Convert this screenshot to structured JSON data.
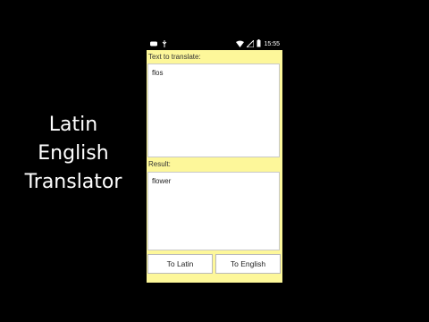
{
  "promo": {
    "line1": "Latin",
    "line2": "English",
    "line3": "Translator"
  },
  "status_bar": {
    "time": "15:55",
    "icons": [
      "notification-icon",
      "usb-icon",
      "wifi-icon",
      "signal-icon",
      "battery-icon"
    ]
  },
  "translator": {
    "input_label": "Text to translate:",
    "input_value": "flos",
    "result_label": "Result:",
    "result_value": "flower",
    "to_latin_label": "To Latin",
    "to_english_label": "To English"
  },
  "colors": {
    "app_background": "#fdf79a",
    "page_background": "#000000"
  }
}
